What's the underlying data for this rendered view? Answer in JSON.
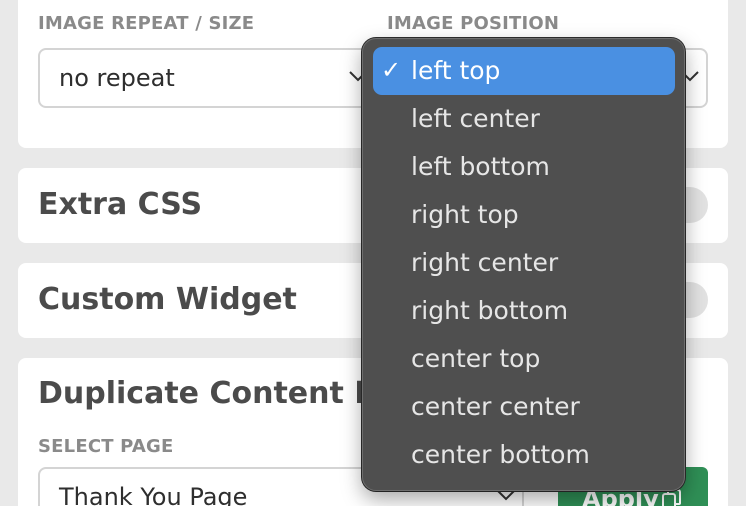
{
  "image_settings": {
    "repeat_label": "IMAGE REPEAT / SIZE",
    "repeat_value": "no repeat",
    "position_label": "IMAGE POSITION"
  },
  "extra_css": {
    "title": "Extra CSS",
    "toggle_on": false
  },
  "custom_widget": {
    "title": "Custom Widget",
    "toggle_on": false
  },
  "duplicate": {
    "title": "Duplicate Content Fro",
    "select_label": "SELECT PAGE",
    "select_value": "Thank You Page",
    "apply_label": "Apply",
    "apply_color": "#2f8f56"
  },
  "position_menu": {
    "selected_index": 0,
    "check_mark": "✓",
    "items": [
      "left top",
      "left center",
      "left bottom",
      "right top",
      "right center",
      "right bottom",
      "center top",
      "center center",
      "center bottom"
    ]
  },
  "colors": {
    "menu_bg": "#4f4f4f",
    "highlight": "#4a90e2",
    "page_bg": "#e9e9e9"
  }
}
